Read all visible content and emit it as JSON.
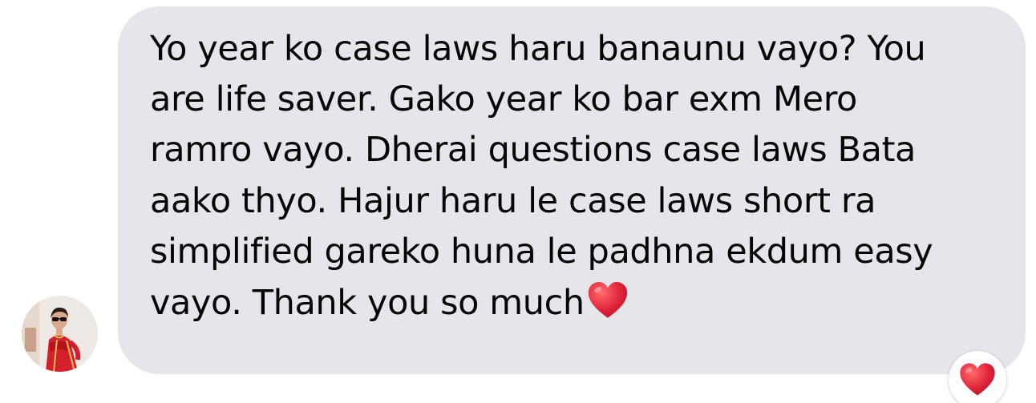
{
  "message": {
    "text": "Yo year ko case laws haru banaunu vayo? You\nare life saver. Gako year ko bar exm Mero\nramro vayo. Dherai questions case laws Bata\naako thyo. Hajur haru le case laws short ra\nsimplified gareko huna le padhna ekdum easy\nvayo. Thank you so much",
    "trailing_emoji": "red-heart-icon"
  },
  "reaction": {
    "emoji": "red-heart-icon"
  },
  "colors": {
    "bubble_bg": "#e4e6eb",
    "text": "#050505",
    "heart": "#e0243a"
  }
}
